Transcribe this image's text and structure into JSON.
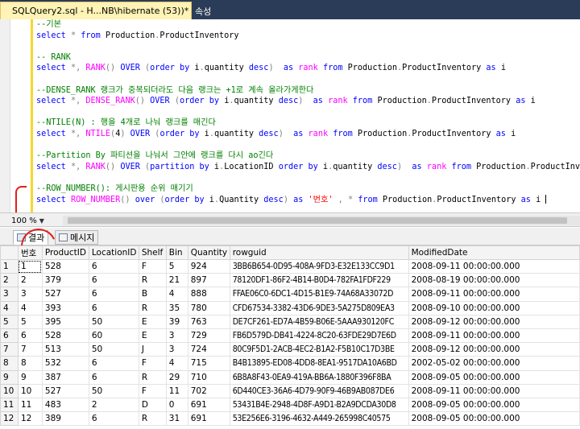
{
  "tabs": {
    "active_title": "SQLQuery2.sql - H...NB\\hibernate (53))*",
    "pin_icon": "pin-icon",
    "close_icon": "close-icon",
    "inactive_title": "속성"
  },
  "editor": {
    "lines": [
      [
        {
          "t": "--기본",
          "c": "cm"
        }
      ],
      [
        {
          "t": "select",
          "c": "kw"
        },
        {
          "t": " ",
          "c": "plain"
        },
        {
          "t": "*",
          "c": "gray"
        },
        {
          "t": " ",
          "c": "plain"
        },
        {
          "t": "from",
          "c": "kw"
        },
        {
          "t": " Production",
          "c": "plain"
        },
        {
          "t": ".",
          "c": "gray"
        },
        {
          "t": "ProductInventory",
          "c": "plain"
        }
      ],
      [
        {
          "t": "",
          "c": "plain"
        }
      ],
      [
        {
          "t": "-- RANK",
          "c": "cm"
        }
      ],
      [
        {
          "t": "select",
          "c": "kw"
        },
        {
          "t": " ",
          "c": "plain"
        },
        {
          "t": "*,",
          "c": "gray"
        },
        {
          "t": " ",
          "c": "plain"
        },
        {
          "t": "RANK",
          "c": "fn"
        },
        {
          "t": "()",
          "c": "gray"
        },
        {
          "t": " ",
          "c": "plain"
        },
        {
          "t": "OVER",
          "c": "kw"
        },
        {
          "t": " ",
          "c": "plain"
        },
        {
          "t": "(",
          "c": "gray"
        },
        {
          "t": "order",
          "c": "kw"
        },
        {
          "t": " ",
          "c": "plain"
        },
        {
          "t": "by",
          "c": "kw"
        },
        {
          "t": " i",
          "c": "plain"
        },
        {
          "t": ".",
          "c": "gray"
        },
        {
          "t": "quantity ",
          "c": "plain"
        },
        {
          "t": "desc",
          "c": "kw"
        },
        {
          "t": ")",
          "c": "gray"
        },
        {
          "t": "  ",
          "c": "plain"
        },
        {
          "t": "as",
          "c": "kw"
        },
        {
          "t": " ",
          "c": "plain"
        },
        {
          "t": "rank",
          "c": "fn"
        },
        {
          "t": " ",
          "c": "plain"
        },
        {
          "t": "from",
          "c": "kw"
        },
        {
          "t": " Production",
          "c": "plain"
        },
        {
          "t": ".",
          "c": "gray"
        },
        {
          "t": "ProductInventory ",
          "c": "plain"
        },
        {
          "t": "as",
          "c": "kw"
        },
        {
          "t": " i",
          "c": "plain"
        }
      ],
      [
        {
          "t": "",
          "c": "plain"
        }
      ],
      [
        {
          "t": "--DENSE_RANK 랭크가 중복되더라도 다음 랭크는 +1로 계속 올라가게한다",
          "c": "cm"
        }
      ],
      [
        {
          "t": "select",
          "c": "kw"
        },
        {
          "t": " ",
          "c": "plain"
        },
        {
          "t": "*,",
          "c": "gray"
        },
        {
          "t": " ",
          "c": "plain"
        },
        {
          "t": "DENSE_RANK",
          "c": "fn"
        },
        {
          "t": "()",
          "c": "gray"
        },
        {
          "t": " ",
          "c": "plain"
        },
        {
          "t": "OVER",
          "c": "kw"
        },
        {
          "t": " ",
          "c": "plain"
        },
        {
          "t": "(",
          "c": "gray"
        },
        {
          "t": "order",
          "c": "kw"
        },
        {
          "t": " ",
          "c": "plain"
        },
        {
          "t": "by",
          "c": "kw"
        },
        {
          "t": " i",
          "c": "plain"
        },
        {
          "t": ".",
          "c": "gray"
        },
        {
          "t": "quantity ",
          "c": "plain"
        },
        {
          "t": "desc",
          "c": "kw"
        },
        {
          "t": ")",
          "c": "gray"
        },
        {
          "t": "  ",
          "c": "plain"
        },
        {
          "t": "as",
          "c": "kw"
        },
        {
          "t": " ",
          "c": "plain"
        },
        {
          "t": "rank",
          "c": "fn"
        },
        {
          "t": " ",
          "c": "plain"
        },
        {
          "t": "from",
          "c": "kw"
        },
        {
          "t": " Production",
          "c": "plain"
        },
        {
          "t": ".",
          "c": "gray"
        },
        {
          "t": "ProductInventory ",
          "c": "plain"
        },
        {
          "t": "as",
          "c": "kw"
        },
        {
          "t": " i",
          "c": "plain"
        }
      ],
      [
        {
          "t": "",
          "c": "plain"
        }
      ],
      [
        {
          "t": "--NTILE(N) : 행을 4개로 나눠 랭크를 매긴다",
          "c": "cm"
        }
      ],
      [
        {
          "t": "select",
          "c": "kw"
        },
        {
          "t": " ",
          "c": "plain"
        },
        {
          "t": "*,",
          "c": "gray"
        },
        {
          "t": " ",
          "c": "plain"
        },
        {
          "t": "NTILE",
          "c": "fn"
        },
        {
          "t": "(",
          "c": "gray"
        },
        {
          "t": "4",
          "c": "plain"
        },
        {
          "t": ")",
          "c": "gray"
        },
        {
          "t": " ",
          "c": "plain"
        },
        {
          "t": "OVER",
          "c": "kw"
        },
        {
          "t": " ",
          "c": "plain"
        },
        {
          "t": "(",
          "c": "gray"
        },
        {
          "t": "order",
          "c": "kw"
        },
        {
          "t": " ",
          "c": "plain"
        },
        {
          "t": "by",
          "c": "kw"
        },
        {
          "t": " i",
          "c": "plain"
        },
        {
          "t": ".",
          "c": "gray"
        },
        {
          "t": "quantity ",
          "c": "plain"
        },
        {
          "t": "desc",
          "c": "kw"
        },
        {
          "t": ")",
          "c": "gray"
        },
        {
          "t": "  ",
          "c": "plain"
        },
        {
          "t": "as",
          "c": "kw"
        },
        {
          "t": " ",
          "c": "plain"
        },
        {
          "t": "rank",
          "c": "fn"
        },
        {
          "t": " ",
          "c": "plain"
        },
        {
          "t": "from",
          "c": "kw"
        },
        {
          "t": " Production",
          "c": "plain"
        },
        {
          "t": ".",
          "c": "gray"
        },
        {
          "t": "ProductInventory ",
          "c": "plain"
        },
        {
          "t": "as",
          "c": "kw"
        },
        {
          "t": " i",
          "c": "plain"
        }
      ],
      [
        {
          "t": "",
          "c": "plain"
        }
      ],
      [
        {
          "t": "--Partition By 파티션을 나눠서 그안에 랭크를 다시 ao긴다",
          "c": "cm"
        }
      ],
      [
        {
          "t": "select",
          "c": "kw"
        },
        {
          "t": " ",
          "c": "plain"
        },
        {
          "t": "*,",
          "c": "gray"
        },
        {
          "t": " ",
          "c": "plain"
        },
        {
          "t": "RANK",
          "c": "fn"
        },
        {
          "t": "()",
          "c": "gray"
        },
        {
          "t": " ",
          "c": "plain"
        },
        {
          "t": "OVER",
          "c": "kw"
        },
        {
          "t": " ",
          "c": "plain"
        },
        {
          "t": "(",
          "c": "gray"
        },
        {
          "t": "partition",
          "c": "kw"
        },
        {
          "t": " ",
          "c": "plain"
        },
        {
          "t": "by",
          "c": "kw"
        },
        {
          "t": " i",
          "c": "plain"
        },
        {
          "t": ".",
          "c": "gray"
        },
        {
          "t": "LocationID ",
          "c": "plain"
        },
        {
          "t": "order",
          "c": "kw"
        },
        {
          "t": " ",
          "c": "plain"
        },
        {
          "t": "by",
          "c": "kw"
        },
        {
          "t": " i",
          "c": "plain"
        },
        {
          "t": ".",
          "c": "gray"
        },
        {
          "t": "quantity ",
          "c": "plain"
        },
        {
          "t": "desc",
          "c": "kw"
        },
        {
          "t": ")",
          "c": "gray"
        },
        {
          "t": "  ",
          "c": "plain"
        },
        {
          "t": "as",
          "c": "kw"
        },
        {
          "t": " ",
          "c": "plain"
        },
        {
          "t": "rank",
          "c": "fn"
        },
        {
          "t": " ",
          "c": "plain"
        },
        {
          "t": "from",
          "c": "kw"
        },
        {
          "t": " Production",
          "c": "plain"
        },
        {
          "t": ".",
          "c": "gray"
        },
        {
          "t": "ProductInventory",
          "c": "plain"
        }
      ],
      [
        {
          "t": "",
          "c": "plain"
        }
      ],
      [
        {
          "t": "--ROW_NUMBER(): 게시판용 순위 매기기",
          "c": "cm"
        }
      ],
      [
        {
          "t": "select",
          "c": "kw"
        },
        {
          "t": " ",
          "c": "plain"
        },
        {
          "t": "ROW_NUMBER",
          "c": "fn"
        },
        {
          "t": "()",
          "c": "gray"
        },
        {
          "t": " ",
          "c": "plain"
        },
        {
          "t": "over",
          "c": "kw"
        },
        {
          "t": " ",
          "c": "plain"
        },
        {
          "t": "(",
          "c": "gray"
        },
        {
          "t": "order",
          "c": "kw"
        },
        {
          "t": " ",
          "c": "plain"
        },
        {
          "t": "by",
          "c": "kw"
        },
        {
          "t": " i",
          "c": "plain"
        },
        {
          "t": ".",
          "c": "gray"
        },
        {
          "t": "Quantity ",
          "c": "plain"
        },
        {
          "t": "desc",
          "c": "kw"
        },
        {
          "t": ")",
          "c": "gray"
        },
        {
          "t": " ",
          "c": "plain"
        },
        {
          "t": "as",
          "c": "kw"
        },
        {
          "t": " ",
          "c": "plain"
        },
        {
          "t": "'번호'",
          "c": "str"
        },
        {
          "t": " ",
          "c": "plain"
        },
        {
          "t": ",",
          "c": "gray"
        },
        {
          "t": " ",
          "c": "plain"
        },
        {
          "t": "*",
          "c": "gray"
        },
        {
          "t": " ",
          "c": "plain"
        },
        {
          "t": "from",
          "c": "kw"
        },
        {
          "t": " Production",
          "c": "plain"
        },
        {
          "t": ".",
          "c": "gray"
        },
        {
          "t": "ProductInventory ",
          "c": "plain"
        },
        {
          "t": "as",
          "c": "kw"
        },
        {
          "t": " i ",
          "c": "plain"
        }
      ]
    ]
  },
  "zoom": {
    "value": "100 %",
    "chevron_icon": "chevron-down-icon"
  },
  "results": {
    "tab_results": "결과",
    "tab_messages": "메시지",
    "grid_icon": "grid-icon",
    "message_icon": "message-icon",
    "columns": [
      "",
      "번호",
      "ProductID",
      "LocationID",
      "Shelf",
      "Bin",
      "Quantity",
      "rowguid",
      "ModifiedDate"
    ],
    "rows": [
      [
        "1",
        "1",
        "528",
        "6",
        "F",
        "5",
        "924",
        "3BB6B654-0D95-408A-9FD3-E32E133CC9D1",
        "2008-09-11 00:00:00.000"
      ],
      [
        "2",
        "2",
        "379",
        "6",
        "R",
        "21",
        "897",
        "78120DF1-86F2-4B14-B0D4-782FA1FDF229",
        "2008-08-19 00:00:00.000"
      ],
      [
        "3",
        "3",
        "527",
        "6",
        "B",
        "4",
        "888",
        "FFAE06C0-6DC1-4D15-B1E9-74A68A33072D",
        "2008-09-11 00:00:00.000"
      ],
      [
        "4",
        "4",
        "393",
        "6",
        "R",
        "35",
        "780",
        "CFD67534-3382-43D6-9DE3-5A275D809EA3",
        "2008-09-10 00:00:00.000"
      ],
      [
        "5",
        "5",
        "395",
        "50",
        "E",
        "39",
        "763",
        "DE7CF261-ED7A-4B59-B06E-5AAA930120FC",
        "2008-09-12 00:00:00.000"
      ],
      [
        "6",
        "6",
        "528",
        "60",
        "E",
        "3",
        "729",
        "FB6D579D-DB41-4224-8C20-63FDE29D7E6D",
        "2008-09-11 00:00:00.000"
      ],
      [
        "7",
        "7",
        "513",
        "50",
        "J",
        "3",
        "724",
        "80C9F5D1-2ACB-4EC2-B1A2-F5B10C17D3BE",
        "2008-09-12 00:00:00.000"
      ],
      [
        "8",
        "8",
        "532",
        "6",
        "F",
        "4",
        "715",
        "B4B13895-ED08-4DD8-8EA1-9517DA10A6BD",
        "2002-05-02 00:00:00.000"
      ],
      [
        "9",
        "9",
        "387",
        "6",
        "R",
        "29",
        "710",
        "6B8A8F43-0EA9-419A-BB6A-1880F396F8BA",
        "2008-09-05 00:00:00.000"
      ],
      [
        "10",
        "10",
        "527",
        "50",
        "F",
        "11",
        "702",
        "6D440CE3-36A6-4D79-90F9-46B9AB087DE6",
        "2008-09-11 00:00:00.000"
      ],
      [
        "11",
        "11",
        "483",
        "2",
        "D",
        "0",
        "691",
        "53431B4E-2948-4D8F-A9D1-B2A9DCDA30D8",
        "2008-09-05 00:00:00.000"
      ],
      [
        "12",
        "12",
        "389",
        "6",
        "R",
        "31",
        "691",
        "53E256E6-3196-4632-A449-265998C40575",
        "2008-09-05 00:00:00.000"
      ]
    ]
  }
}
